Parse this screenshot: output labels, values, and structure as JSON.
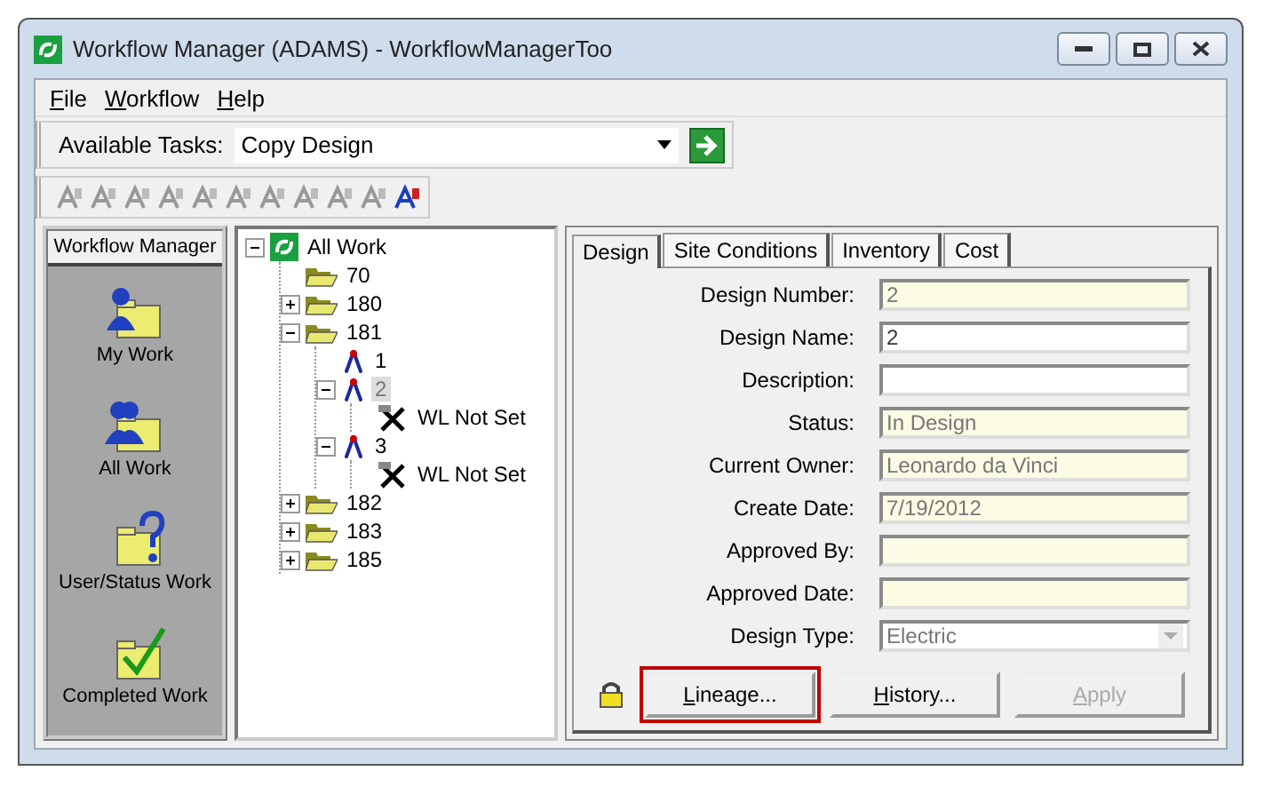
{
  "window": {
    "title": "Workflow Manager (ADAMS) - WorkflowManagerToo"
  },
  "menu": [
    {
      "label": "File"
    },
    {
      "label": "Workflow"
    },
    {
      "label": "Help"
    }
  ],
  "task_bar": {
    "label": "Available Tasks:",
    "value": "Copy Design"
  },
  "toolbar": [
    {
      "disabled": true
    },
    {
      "disabled": true
    },
    {
      "disabled": true
    },
    {
      "disabled": true
    },
    {
      "disabled": true
    },
    {
      "disabled": true
    },
    {
      "disabled": true
    },
    {
      "disabled": true
    },
    {
      "disabled": true
    },
    {
      "disabled": true
    },
    {
      "disabled": false
    }
  ],
  "sidebar": {
    "title": "Workflow Manager",
    "items": [
      {
        "kind": "mywork",
        "label": "My Work"
      },
      {
        "kind": "allwork",
        "label": "All Work"
      },
      {
        "kind": "userstatus",
        "label": "User/Status Work"
      },
      {
        "kind": "completed",
        "label": "Completed Work"
      }
    ]
  },
  "tree": [
    {
      "kind": "root",
      "label": "All Work",
      "expanded": true,
      "selected": false,
      "children": [
        {
          "kind": "folder",
          "label": "70",
          "selected": false
        },
        {
          "kind": "folder",
          "label": "180",
          "expanded": false,
          "selected": false
        },
        {
          "kind": "folder",
          "label": "181",
          "expanded": true,
          "selected": false,
          "children": [
            {
              "kind": "design",
              "label": "1",
              "selected": false
            },
            {
              "kind": "design",
              "label": "2",
              "expanded": true,
              "selected": true,
              "children": [
                {
                  "kind": "worklocation",
                  "label": "WL Not Set",
                  "selected": false
                }
              ]
            },
            {
              "kind": "design",
              "label": "3",
              "expanded": true,
              "selected": false,
              "children": [
                {
                  "kind": "worklocation",
                  "label": "WL Not Set",
                  "selected": false
                }
              ]
            }
          ]
        },
        {
          "kind": "folder",
          "label": "182",
          "expanded": false,
          "selected": false
        },
        {
          "kind": "folder",
          "label": "183",
          "expanded": false,
          "selected": false
        },
        {
          "kind": "folder",
          "label": "185",
          "expanded": false,
          "selected": false
        }
      ]
    }
  ],
  "tabs": [
    {
      "label": "Design",
      "selected": true
    },
    {
      "label": "Site Conditions",
      "selected": false
    },
    {
      "label": "Inventory",
      "selected": false
    },
    {
      "label": "Cost",
      "selected": false
    }
  ],
  "fields": [
    {
      "kind": "text",
      "label": "Design Number:",
      "value": "2",
      "readonly": true
    },
    {
      "kind": "text",
      "label": "Design Name:",
      "value": "2",
      "readonly": false
    },
    {
      "kind": "text",
      "label": "Description:",
      "readonly": false
    },
    {
      "kind": "text",
      "label": "Status:",
      "value": "In Design",
      "readonly": true
    },
    {
      "kind": "text",
      "label": "Current Owner:",
      "value": "Leonardo da Vinci",
      "readonly": true
    },
    {
      "kind": "text",
      "label": "Create Date:",
      "value": "7/19/2012",
      "readonly": true
    },
    {
      "kind": "text",
      "label": "Approved By:",
      "readonly": true
    },
    {
      "kind": "text",
      "label": "Approved Date:",
      "readonly": true
    },
    {
      "kind": "dropdown",
      "label": "Design Type:",
      "value": "Electric",
      "disabled": true
    }
  ],
  "locked": true,
  "buttons": [
    {
      "label": "Lineage...",
      "disabled": false,
      "highlighted": true
    },
    {
      "label": "History...",
      "disabled": false,
      "highlighted": false
    },
    {
      "label": "Apply",
      "disabled": true,
      "highlighted": false
    }
  ]
}
